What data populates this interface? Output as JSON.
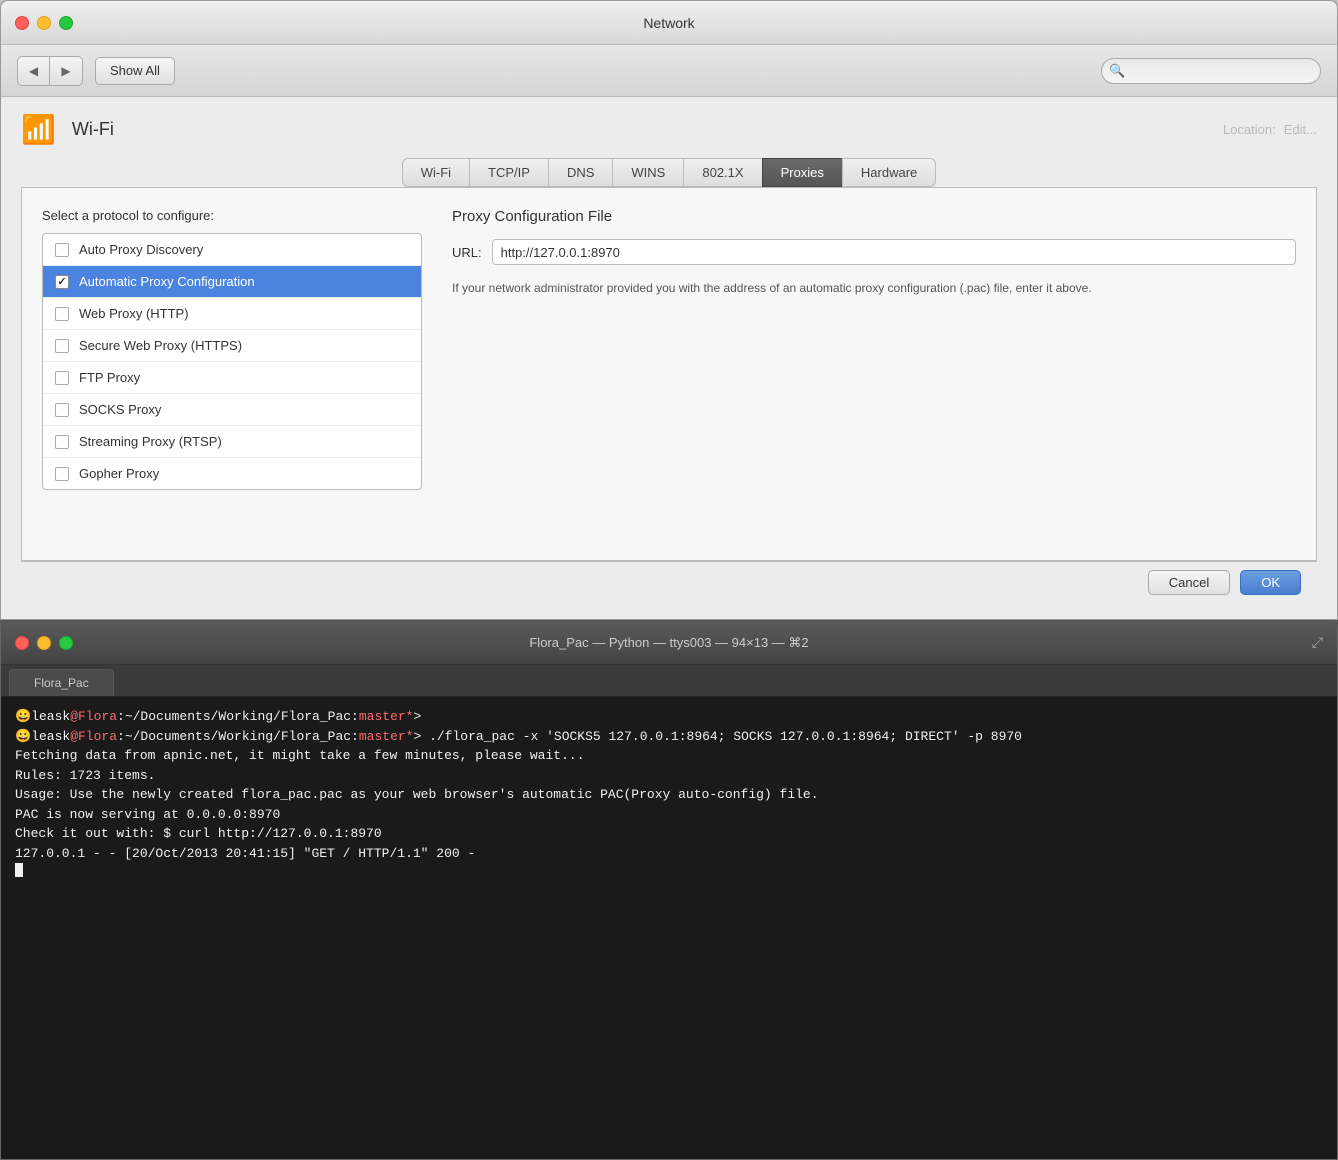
{
  "network_window": {
    "title": "Network",
    "controls": {
      "close": "close",
      "minimize": "minimize",
      "maximize": "maximize"
    },
    "toolbar": {
      "back_label": "◀",
      "forward_label": "▶",
      "show_all_label": "Show All",
      "search_placeholder": ""
    },
    "header": {
      "wifi_title": "Wi-Fi",
      "location_label": "Location:",
      "location_value": "Edit..."
    },
    "tabs": [
      {
        "id": "wifi",
        "label": "Wi-Fi",
        "active": false
      },
      {
        "id": "tcpip",
        "label": "TCP/IP",
        "active": false
      },
      {
        "id": "dns",
        "label": "DNS",
        "active": false
      },
      {
        "id": "wins",
        "label": "WINS",
        "active": false
      },
      {
        "id": "8021x",
        "label": "802.1X",
        "active": false
      },
      {
        "id": "proxies",
        "label": "Proxies",
        "active": true
      },
      {
        "id": "hardware",
        "label": "Hardware",
        "active": false
      }
    ],
    "proxies": {
      "section_label": "Select a protocol to configure:",
      "protocols": [
        {
          "id": "auto-discovery",
          "label": "Auto Proxy Discovery",
          "checked": false
        },
        {
          "id": "auto-config",
          "label": "Automatic Proxy Configuration",
          "checked": true
        },
        {
          "id": "web-proxy",
          "label": "Web Proxy (HTTP)",
          "checked": false
        },
        {
          "id": "secure-web",
          "label": "Secure Web Proxy (HTTPS)",
          "checked": false
        },
        {
          "id": "ftp-proxy",
          "label": "FTP Proxy",
          "checked": false
        },
        {
          "id": "socks-proxy",
          "label": "SOCKS Proxy",
          "checked": false
        },
        {
          "id": "streaming",
          "label": "Streaming Proxy (RTSP)",
          "checked": false
        },
        {
          "id": "gopher",
          "label": "Gopher Proxy",
          "checked": false
        }
      ],
      "config_title": "Proxy Configuration File",
      "url_label": "URL:",
      "url_value": "http://127.0.0.1:8970",
      "description": "If your network administrator provided you with the address of an automatic proxy configuration (.pac) file, enter it above."
    },
    "bottom_bar": {
      "cancel_label": "Cancel",
      "ok_label": "OK"
    }
  },
  "terminal_window": {
    "title": "Flora_Pac — Python — ttys003 — 94×13 — ⌘2",
    "tab_label": "Flora_Pac",
    "lines": [
      {
        "type": "prompt",
        "emoji": "😀",
        "user": "leask",
        "at": "@",
        "host": "Flora",
        "path": ":~/Documents/Working/Flora_Pac:",
        "branch": "master",
        "star": "*",
        "arrow": ">"
      },
      {
        "type": "command",
        "emoji": "😀",
        "user": "leask",
        "at": "@",
        "host": "Flora",
        "path": ":~/Documents/Working/Flora_Pac:",
        "branch": "master",
        "star": "*",
        "arrow": ">",
        "cmd": " ./flora_pac -x 'SOCKS5 127.0.0.1:8964; SOCKS 127.0.0.1:8964; DIRECT' -p 8970"
      },
      {
        "type": "output",
        "text": "Fetching data from apnic.net, it might take a few minutes, please wait..."
      },
      {
        "type": "output",
        "text": "Rules: 1723 items."
      },
      {
        "type": "output",
        "text": "Usage: Use the newly created flora_pac.pac as your web browser's automatic PAC(Proxy auto-config) file."
      },
      {
        "type": "output",
        "text": "PAC is now serving at 0.0.0.0:8970"
      },
      {
        "type": "output",
        "text": "Check it out with: $ curl http://127.0.0.1:8970"
      },
      {
        "type": "output",
        "text": "127.0.0.1 - - [20/Oct/2013 20:41:15] \"GET / HTTP/1.1\" 200 -"
      },
      {
        "type": "cursor"
      }
    ]
  }
}
